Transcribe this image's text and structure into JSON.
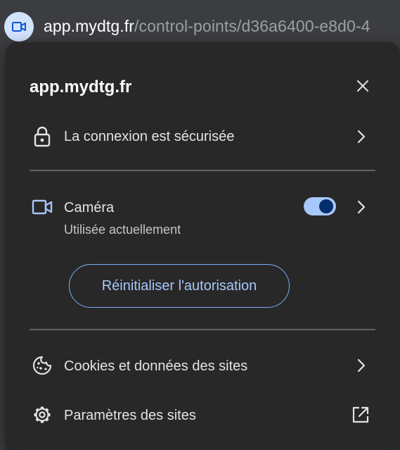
{
  "address_bar": {
    "url_host": "app.mydtg.fr",
    "url_path": "/control-points/d36a6400-e8d0-4",
    "site_info_icon": "camera-icon",
    "chip_color": "#d3e3fd"
  },
  "bubble": {
    "title": "app.mydtg.fr",
    "close_icon": "close-icon",
    "connection": {
      "label": "La connexion est sécurisée",
      "icon": "lock-icon"
    },
    "camera": {
      "label": "Caméra",
      "status": "Utilisée actuellement",
      "icon": "video-camera-icon",
      "toggle_on": true,
      "accent_color": "#a8c7fa"
    },
    "reset_button_label": "Réinitialiser l'autorisation",
    "cookies": {
      "label": "Cookies et données des sites",
      "icon": "cookie-icon"
    },
    "site_settings": {
      "label": "Paramètres des sites",
      "icon": "gear-icon",
      "trailing_icon": "open-external-icon"
    }
  }
}
